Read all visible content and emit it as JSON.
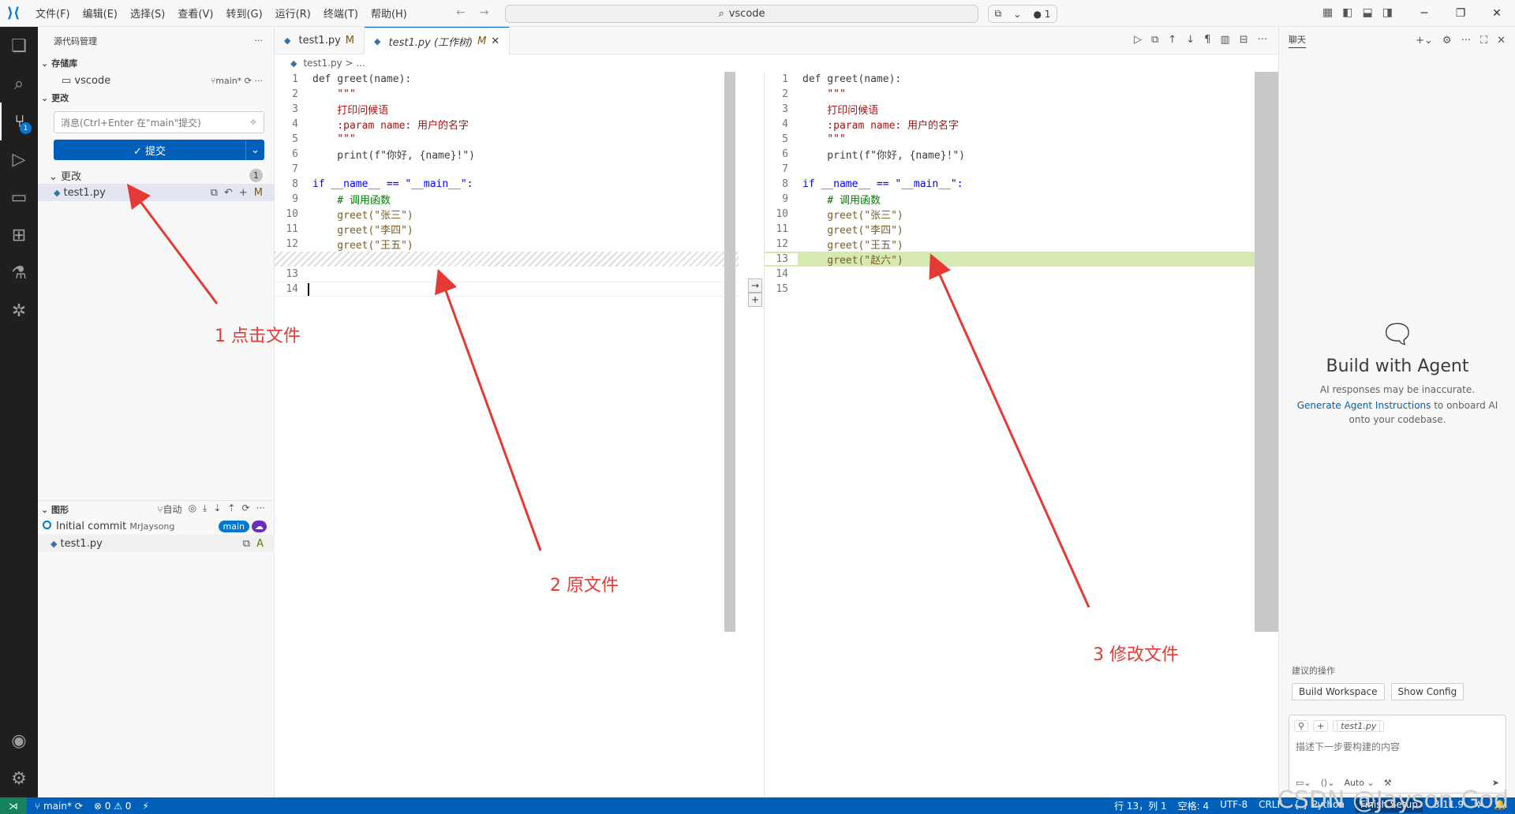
{
  "titlebar": {
    "menus": [
      "文件(F)",
      "编辑(E)",
      "选择(S)",
      "查看(V)",
      "转到(G)",
      "运行(R)",
      "终端(T)",
      "帮助(H)"
    ],
    "search": "vscode",
    "copilot_count": "1"
  },
  "sidebar": {
    "title": "源代码管理",
    "repos_label": "存储库",
    "repo_name": "vscode",
    "repo_branch": "main*",
    "changes_section": "更改",
    "message_placeholder": "消息(Ctrl+Enter 在\"main\"提交)",
    "commit_label": "✓ 提交",
    "changes_group": "更改",
    "changes_count": "1",
    "file_name": "test1.py",
    "file_status": "M",
    "graph_label": "图形",
    "graph_auto": "自动",
    "commit_title": "Initial commit",
    "commit_author": "MrJaysong",
    "commit_branch": "main",
    "commit_file": "test1.py",
    "commit_file_status": "A"
  },
  "editor": {
    "tabs": [
      {
        "label": "test1.py",
        "status": "M"
      },
      {
        "label": "test1.py (工作树)",
        "status": "M"
      }
    ],
    "breadcrumb": "test1.py > ..."
  },
  "code_left": [
    {
      "n": "1",
      "t": "def greet(name):"
    },
    {
      "n": "2",
      "t": "    \"\"\""
    },
    {
      "n": "3",
      "t": "    打印问候语"
    },
    {
      "n": "4",
      "t": "    :param name: 用户的名字"
    },
    {
      "n": "5",
      "t": "    \"\"\""
    },
    {
      "n": "6",
      "t": "    print(f\"你好, {name}!\")"
    },
    {
      "n": "7",
      "t": ""
    },
    {
      "n": "8",
      "t": "if __name__ == \"__main__\":"
    },
    {
      "n": "9",
      "t": "    # 调用函数"
    },
    {
      "n": "10",
      "t": "    greet(\"张三\")"
    },
    {
      "n": "11",
      "t": "    greet(\"李四\")"
    },
    {
      "n": "12",
      "t": "    greet(\"王五\")"
    },
    {
      "n": "",
      "t": ""
    },
    {
      "n": "13",
      "t": ""
    },
    {
      "n": "14",
      "t": ""
    }
  ],
  "code_right": [
    {
      "n": "1",
      "t": "def greet(name):"
    },
    {
      "n": "2",
      "t": "    \"\"\""
    },
    {
      "n": "3",
      "t": "    打印问候语"
    },
    {
      "n": "4",
      "t": "    :param name: 用户的名字"
    },
    {
      "n": "5",
      "t": "    \"\"\""
    },
    {
      "n": "6",
      "t": "    print(f\"你好, {name}!\")"
    },
    {
      "n": "7",
      "t": ""
    },
    {
      "n": "8",
      "t": "if __name__ == \"__main__\":"
    },
    {
      "n": "9",
      "t": "    # 调用函数"
    },
    {
      "n": "10",
      "t": "    greet(\"张三\")"
    },
    {
      "n": "11",
      "t": "    greet(\"李四\")"
    },
    {
      "n": "12",
      "t": "    greet(\"王五\")"
    },
    {
      "n": "13",
      "t": "    greet(\"赵六\")"
    },
    {
      "n": "14",
      "t": ""
    },
    {
      "n": "15",
      "t": ""
    }
  ],
  "chat": {
    "title": "聊天",
    "heading": "Build with Agent",
    "disclaimer": "AI responses may be inaccurate.",
    "link": "Generate Agent Instructions",
    "link_rest": " to onboard AI onto your codebase.",
    "suggest_label": "建议的操作",
    "suggest_1": "Build Workspace",
    "suggest_2": "Show Config",
    "context_file": "test1.py",
    "input_placeholder": "描述下一步要构建的内容",
    "mode": "Auto"
  },
  "status": {
    "branch": "main*",
    "problems": "⊗ 0 ⚠ 0",
    "position": "行 13，列 1",
    "spaces": "空格: 4",
    "encoding": "UTF-8",
    "eol": "CRLF",
    "language": "{ } Python",
    "setup": "Finish Setup",
    "version": "3.11.9"
  },
  "annotations": {
    "a1": "1 点击文件",
    "a2": "2 原文件",
    "a3": "3 修改文件",
    "watermark": "CSDN @Jayson God"
  },
  "colors": {
    "accent": "#005fb8",
    "added": "#d5e9b0",
    "annotation": "#e53935"
  }
}
